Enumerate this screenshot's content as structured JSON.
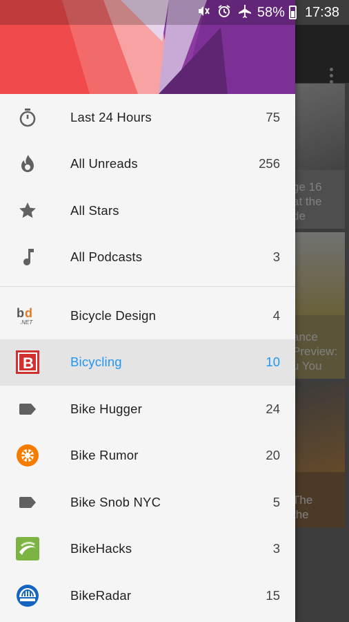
{
  "status_bar": {
    "icons": [
      "mute-icon",
      "alarm-icon",
      "airplane-mode-icon",
      "battery-icon"
    ],
    "battery": "58%",
    "time": "17:38"
  },
  "background": {
    "toolbar_icon": "overflow-menu-icon",
    "cards": [
      {
        "caption_lines": [
          "ge 16",
          "at the",
          "de"
        ]
      },
      {
        "caption_lines": [
          "ance",
          "Preview:",
          "u You"
        ]
      },
      {
        "caption_lines": [
          "The",
          "the"
        ]
      }
    ]
  },
  "drawer": {
    "smart_items": [
      {
        "icon": "timer-icon",
        "label": "Last 24 Hours",
        "count": "75"
      },
      {
        "icon": "flame-icon",
        "label": "All Unreads",
        "count": "256"
      },
      {
        "icon": "star-icon",
        "label": "All Stars",
        "count": ""
      },
      {
        "icon": "music-note-icon",
        "label": "All Podcasts",
        "count": "3"
      }
    ],
    "feeds": [
      {
        "icon": "bicycle-design-logo-icon",
        "label": "Bicycle Design",
        "count": "4",
        "selected": false
      },
      {
        "icon": "bicycling-logo-icon",
        "label": "Bicycling",
        "count": "10",
        "selected": true
      },
      {
        "icon": "tag-icon",
        "label": "Bike Hugger",
        "count": "24",
        "selected": false
      },
      {
        "icon": "bike-rumor-logo-icon",
        "label": "Bike Rumor",
        "count": "20",
        "selected": false
      },
      {
        "icon": "tag-icon",
        "label": "Bike Snob NYC",
        "count": "5",
        "selected": false
      },
      {
        "icon": "bikehacks-logo-icon",
        "label": "BikeHacks",
        "count": "3",
        "selected": false
      },
      {
        "icon": "bikeradar-logo-icon",
        "label": "BikeRadar",
        "count": "15",
        "selected": false
      }
    ]
  },
  "colors": {
    "accent": "#2196f3",
    "drawer_bg": "#f5f5f5",
    "selected_bg": "#e4e4e4",
    "icon_gray": "#616161"
  }
}
